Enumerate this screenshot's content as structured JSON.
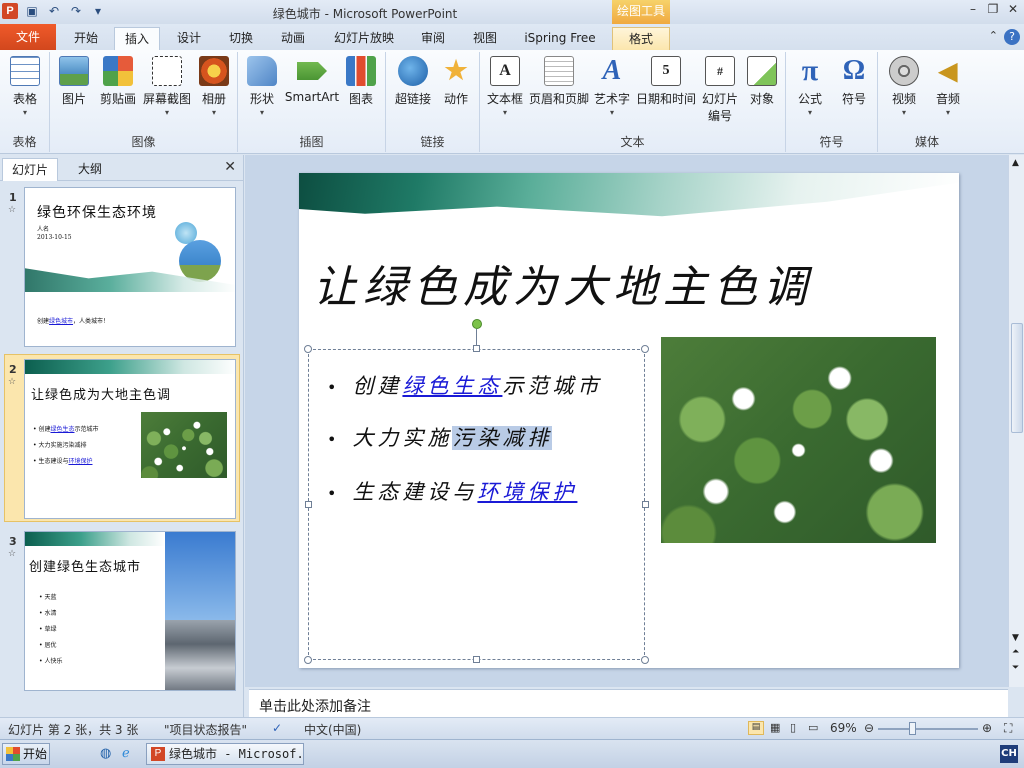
{
  "window": {
    "title": "绿色城市 - Microsoft PowerPoint",
    "contextual_tab_group": "绘图工具"
  },
  "tabs": [
    {
      "label": "文件"
    },
    {
      "label": "开始"
    },
    {
      "label": "插入"
    },
    {
      "label": "设计"
    },
    {
      "label": "切换"
    },
    {
      "label": "动画"
    },
    {
      "label": "幻灯片放映"
    },
    {
      "label": "审阅"
    },
    {
      "label": "视图"
    },
    {
      "label": "iSpring Free"
    },
    {
      "label": "格式"
    }
  ],
  "ribbon": {
    "groups": [
      "表格",
      "图像",
      "插图",
      "链接",
      "文本",
      "符号",
      "媒体"
    ],
    "buttons": {
      "table": "表格",
      "picture": "图片",
      "clipart": "剪贴画",
      "screenshot": "屏幕截图",
      "album": "相册",
      "shapes": "形状",
      "smartart": "SmartArt",
      "chart": "图表",
      "hyperlink": "超链接",
      "action": "动作",
      "textbox": "文本框",
      "header_footer": "页眉和页脚",
      "wordart": "艺术字",
      "datetime": "日期和时间",
      "slide_number_1": "幻灯片",
      "slide_number_2": "编号",
      "object": "对象",
      "equation": "公式",
      "symbol": "符号",
      "video": "视频",
      "audio": "音频"
    }
  },
  "pane": {
    "tabs": [
      "幻灯片",
      "大纲"
    ],
    "thumbs": [
      {
        "num": "1",
        "title": "绿色环保生态环境",
        "author": "人名",
        "date": "2013-10-15",
        "footer_pre": "创建",
        "footer_link": "绿色城市",
        "footer_post": "，人类城市！"
      },
      {
        "num": "2",
        "title": "让绿色成为大地主色调",
        "b1_pre": "创建",
        "b1_link": "绿色生态",
        "b1_post": "示范城市",
        "b2": "大力实施污染减排",
        "b3_pre": "生态建设与",
        "b3_link": "环境保护"
      },
      {
        "num": "3",
        "title": "创建绿色生态城市",
        "bullets": [
          "天蓝",
          "水清",
          "草绿",
          "居优",
          "人快乐"
        ]
      }
    ]
  },
  "slide": {
    "title": "让绿色成为大地主色调",
    "bullet1_pre": "创建",
    "bullet1_link": "绿色生态",
    "bullet1_post": "示范城市",
    "bullet2_pre": "大力实施",
    "bullet2_hl": "污染减排",
    "bullet3_pre": "生态建设与",
    "bullet3_link": "环境保护"
  },
  "notes": {
    "placeholder": "单击此处添加备注"
  },
  "status": {
    "slide_info": "幻灯片 第 2 张，共 3 张",
    "theme": "\"项目状态报告\"",
    "language": "中文(中国)",
    "zoom": "69%"
  },
  "taskbar": {
    "start": "开始",
    "item": "绿色城市 - Microsof...",
    "ime": "CH"
  }
}
